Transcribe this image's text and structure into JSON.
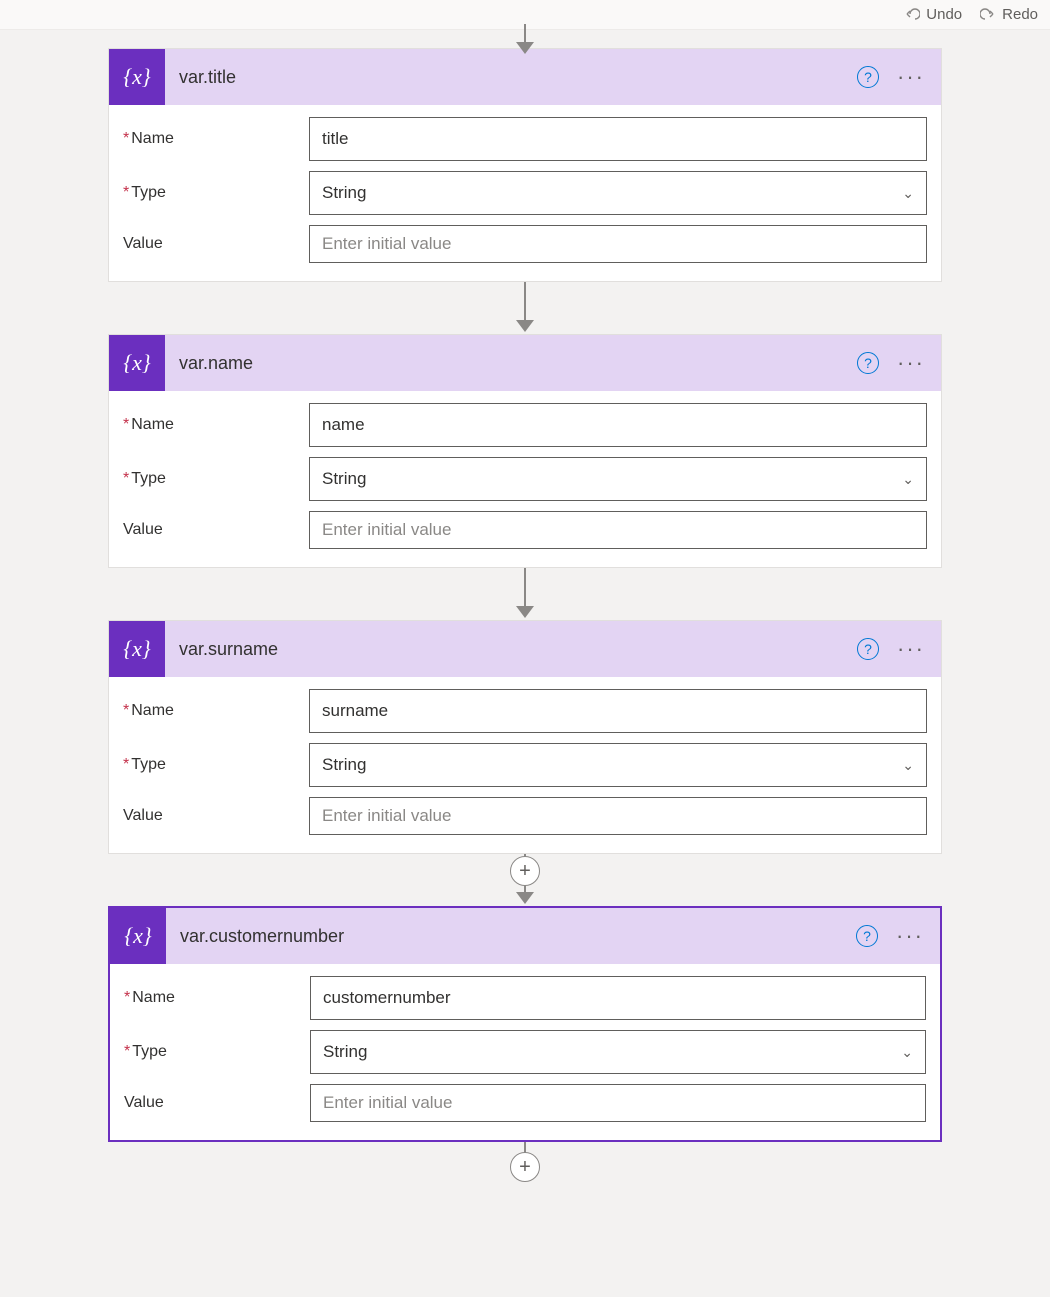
{
  "topbar": {
    "undo": "Undo",
    "redo": "Redo"
  },
  "labels": {
    "name": "Name",
    "type": "Type",
    "value": "Value",
    "required_marker": "*",
    "value_placeholder": "Enter initial value",
    "help_symbol": "?",
    "more_symbol": "···",
    "plus_symbol": "+",
    "icon_text": "{x}",
    "chevron": "⌄"
  },
  "cards": [
    {
      "title": "var.title",
      "name_value": "title",
      "type_value": "String",
      "value_value": "",
      "selected": false
    },
    {
      "title": "var.name",
      "name_value": "name",
      "type_value": "String",
      "value_value": "",
      "selected": false
    },
    {
      "title": "var.surname",
      "name_value": "surname",
      "type_value": "String",
      "value_value": "",
      "selected": false
    },
    {
      "title": "var.customernumber",
      "name_value": "customernumber",
      "type_value": "String",
      "value_value": "",
      "selected": true
    }
  ]
}
